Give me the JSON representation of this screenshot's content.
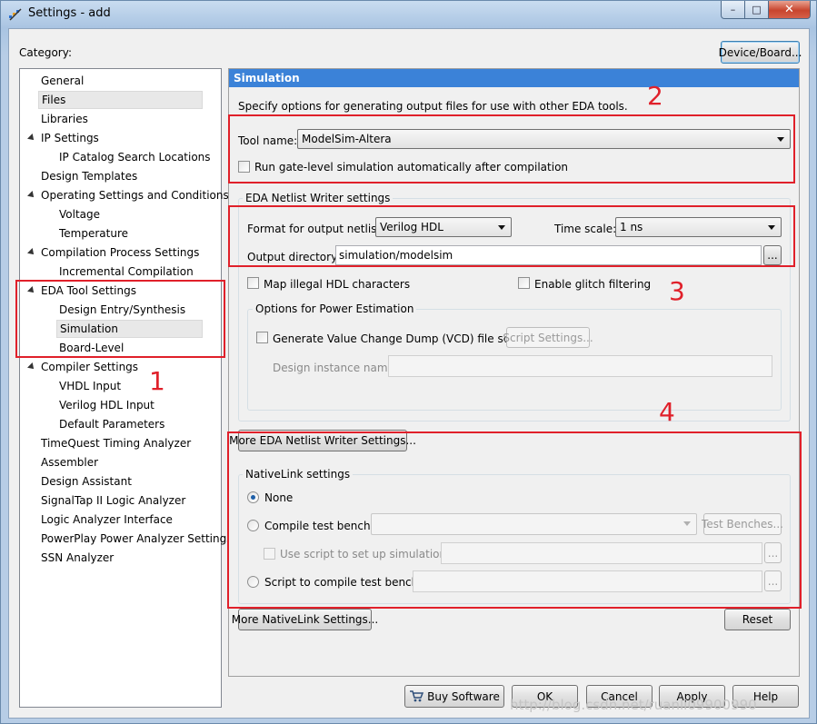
{
  "window": {
    "title": "Settings - add",
    "buttons": {
      "minimize": "–",
      "maximize": "□",
      "close": "✕"
    }
  },
  "category_label": "Category:",
  "device_board_button": "Device/Board...",
  "tree": [
    {
      "label": "General",
      "expander": false
    },
    {
      "label": "Files",
      "expander": false,
      "selected": true
    },
    {
      "label": "Libraries",
      "expander": false
    },
    {
      "label": "IP Settings",
      "expander": true
    },
    {
      "label": "IP Catalog Search Locations",
      "expander": false
    },
    {
      "label": "Design Templates",
      "expander": false
    },
    {
      "label": "Operating Settings and Conditions",
      "expander": true
    },
    {
      "label": "Voltage",
      "expander": false
    },
    {
      "label": "Temperature",
      "expander": false
    },
    {
      "label": "Compilation Process Settings",
      "expander": true
    },
    {
      "label": "Incremental Compilation",
      "expander": false
    },
    {
      "label": "EDA Tool Settings",
      "expander": true
    },
    {
      "label": "Design Entry/Synthesis",
      "expander": false
    },
    {
      "label": "Simulation",
      "expander": false,
      "selected": true
    },
    {
      "label": "Board-Level",
      "expander": false
    },
    {
      "label": "Compiler Settings",
      "expander": true
    },
    {
      "label": "VHDL Input",
      "expander": false
    },
    {
      "label": "Verilog HDL Input",
      "expander": false
    },
    {
      "label": "Default Parameters",
      "expander": false
    },
    {
      "label": "TimeQuest Timing Analyzer",
      "expander": false
    },
    {
      "label": "Assembler",
      "expander": false
    },
    {
      "label": "Design Assistant",
      "expander": false
    },
    {
      "label": "SignalTap II Logic Analyzer",
      "expander": false
    },
    {
      "label": "Logic Analyzer Interface",
      "expander": false
    },
    {
      "label": "PowerPlay Power Analyzer Settings",
      "expander": false
    },
    {
      "label": "SSN Analyzer",
      "expander": false
    }
  ],
  "panel": {
    "title": "Simulation",
    "description": "Specify options for generating output files for use with other EDA tools.",
    "tool_name_label": "Tool name:",
    "tool_name_value": "ModelSim-Altera",
    "gate_level_label": "Run gate-level simulation automatically after compilation",
    "netlist_group_title": "EDA Netlist Writer settings",
    "format_label": "Format for output netlist:",
    "format_value": "Verilog HDL",
    "timescale_label": "Time scale:",
    "timescale_value": "1 ns",
    "output_dir_label": "Output directory:",
    "output_dir_value": "simulation/modelsim",
    "browse_label": "...",
    "map_illegal_label": "Map illegal HDL characters",
    "glitch_label": "Enable glitch filtering",
    "power_group_title": "Options for Power Estimation",
    "vcd_label": "Generate Value Change Dump (VCD) file script",
    "script_settings_button": "Script Settings...",
    "design_instance_label": "Design instance name:",
    "more_eda_button": "More EDA Netlist Writer Settings...",
    "nativelink_group_title": "NativeLink settings",
    "none_label": "None",
    "compile_tb_label": "Compile test bench:",
    "test_benches_button": "Test Benches...",
    "use_script_label": "Use script to set up simulation:",
    "script_compile_label": "Script to compile test bench:",
    "more_nativelink_button": "More NativeLink Settings...",
    "reset_button": "Reset"
  },
  "footer": {
    "buy_software": "Buy Software",
    "ok": "OK",
    "cancel": "Cancel",
    "apply": "Apply",
    "help": "Help"
  },
  "annotations": [
    "1",
    "2",
    "3",
    "4"
  ],
  "watermark": "http://blog.csdn.net/ruanli09900990",
  "colors": {
    "panel_header": "#3b82d8",
    "annotation_red": "#e0202a"
  }
}
